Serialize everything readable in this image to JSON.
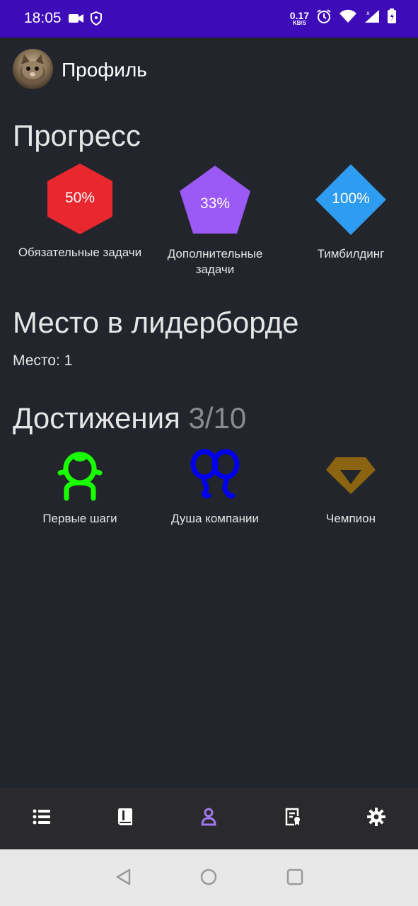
{
  "status_bar": {
    "time": "18:05",
    "net_speed_value": "0.17",
    "net_speed_unit": "KB/S",
    "background": "#3d0bb8"
  },
  "header": {
    "title": "Профиль"
  },
  "progress": {
    "title": "Прогресс",
    "items": [
      {
        "label": "Обязательные задачи",
        "percent_text": "50%",
        "color": "#e8282e",
        "shape": "hexagon"
      },
      {
        "label": "Дополнительные задачи",
        "percent_text": "33%",
        "color": "#9b59f5",
        "shape": "pentagon"
      },
      {
        "label": "Тимбилдинг",
        "percent_text": "100%",
        "color": "#2e9cf0",
        "shape": "diamond"
      }
    ]
  },
  "leaderboard": {
    "title": "Место в лидерборде",
    "place_text": "Место: 1"
  },
  "achievements": {
    "title": "Достижения",
    "count": "3/10",
    "items": [
      {
        "label": "Первые шаги",
        "icon": "child-face-icon",
        "color": "#1aff00"
      },
      {
        "label": "Душа компании",
        "icon": "balloons-icon",
        "color": "#0000ee"
      },
      {
        "label": "Чемпион",
        "icon": "diamond-icon",
        "color": "#8a6410"
      }
    ]
  },
  "bottom_nav": {
    "items": [
      {
        "name": "tasks-list",
        "icon": "list-icon",
        "active": false
      },
      {
        "name": "book",
        "icon": "book-icon",
        "active": false
      },
      {
        "name": "profile",
        "icon": "person-icon",
        "active": true
      },
      {
        "name": "certificates",
        "icon": "certificate-icon",
        "active": false
      },
      {
        "name": "settings",
        "icon": "gear-icon",
        "active": false
      }
    ],
    "active_color": "#a078f0",
    "inactive_color": "#ffffff"
  }
}
